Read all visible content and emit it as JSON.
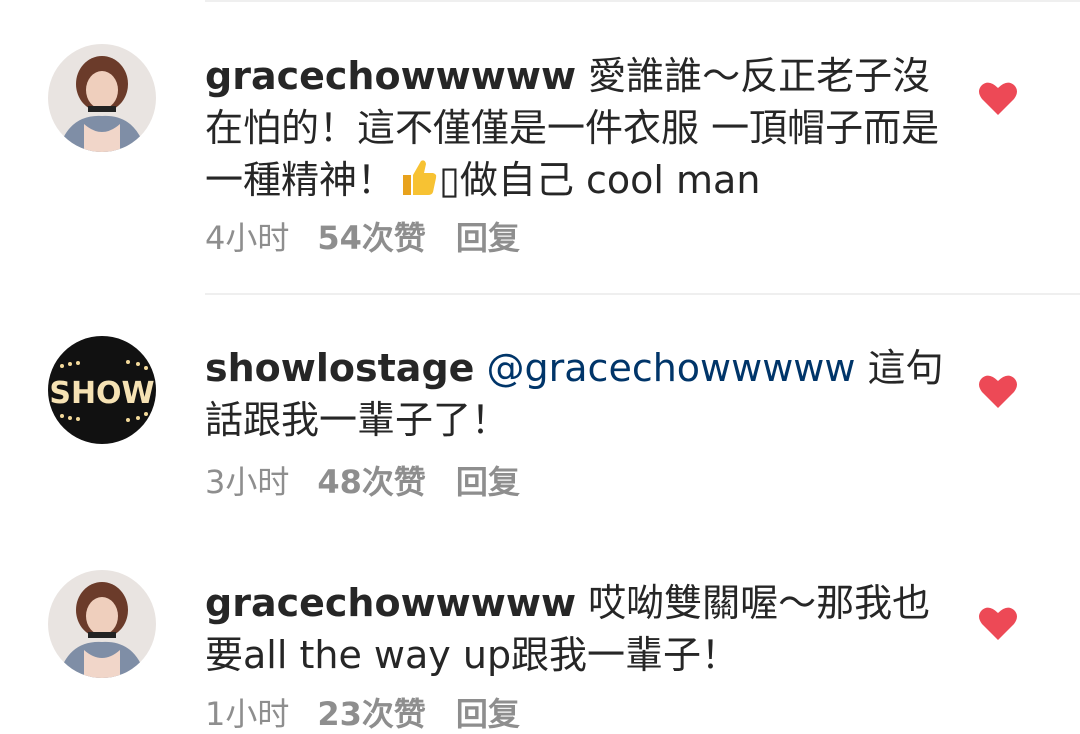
{
  "comments": [
    {
      "username": "gracechowwwww",
      "text_before_emoji": " 愛誰誰～反正老子沒在怕的！這不僅僅是一件衣服 一頂帽子而是一種精神！",
      "emoji_icon": "thumbs-up-icon",
      "text_after_emoji": "▯做自己 cool man",
      "time": "4小时",
      "likes": "54次赞",
      "reply_label": "回复",
      "liked": true
    },
    {
      "username": "showlostage",
      "mention": "@gracechowwwww",
      "text": " 這句話跟我一輩子了！",
      "avatar_text": "SHOW",
      "time": "3小时",
      "likes": "48次赞",
      "reply_label": "回复",
      "liked": true
    },
    {
      "username": "gracechowwwww",
      "text": " 哎呦雙關喔～那我也要all the way up跟我一輩子！",
      "time": "1小时",
      "likes": "23次赞",
      "reply_label": "回复",
      "liked": true
    }
  ],
  "colors": {
    "heart": "#ed4956",
    "meta_text": "#8e8e8e",
    "mention": "#003569",
    "divider": "#efefef"
  }
}
